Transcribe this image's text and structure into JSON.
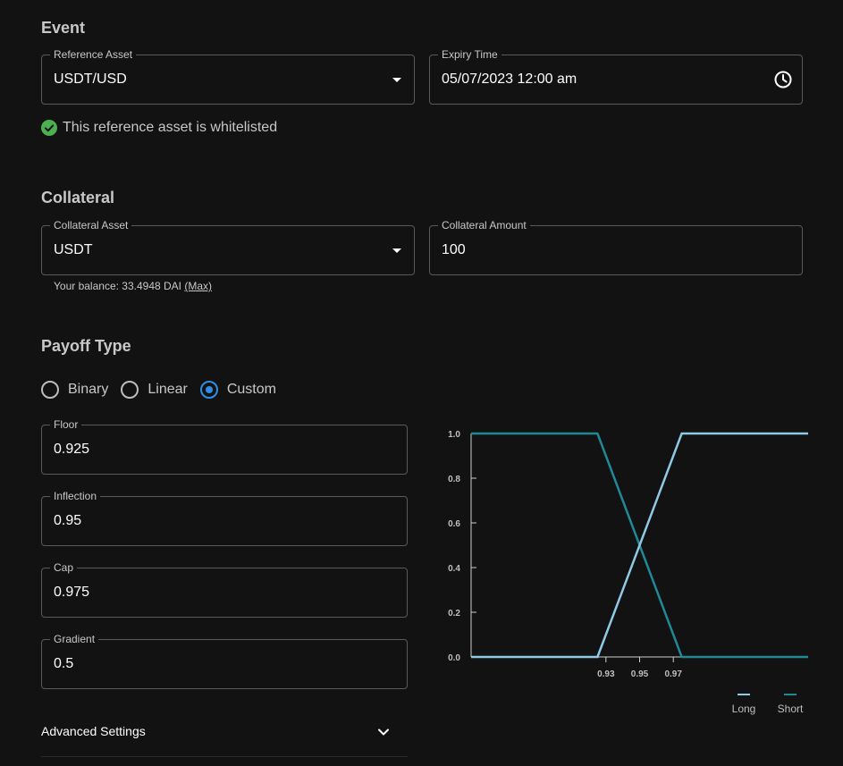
{
  "event": {
    "title": "Event",
    "reference_asset": {
      "label": "Reference Asset",
      "value": "USDT/USD"
    },
    "expiry_time": {
      "label": "Expiry Time",
      "value": "05/07/2023 12:00 am"
    },
    "whitelist_msg": "This reference asset is whitelisted"
  },
  "collateral": {
    "title": "Collateral",
    "asset": {
      "label": "Collateral Asset",
      "value": "USDT"
    },
    "amount": {
      "label": "Collateral Amount",
      "value": "100"
    },
    "balance_text": "Your balance: 33.4948 DAI",
    "max_label": "(Max)"
  },
  "payoff": {
    "title": "Payoff Type",
    "options": [
      "Binary",
      "Linear",
      "Custom"
    ],
    "selected": "Custom",
    "floor": {
      "label": "Floor",
      "value": "0.925"
    },
    "inflection": {
      "label": "Inflection",
      "value": "0.95"
    },
    "cap": {
      "label": "Cap",
      "value": "0.975"
    },
    "gradient": {
      "label": "Gradient",
      "value": "0.5"
    }
  },
  "advanced": {
    "label": "Advanced Settings"
  },
  "colors": {
    "long": "#8ecae6",
    "short": "#1f8a96",
    "accent": "#2e8ee6",
    "success": "#4caf50"
  },
  "chart_data": {
    "type": "line",
    "x_tick_labels": [
      "0.93",
      "0.95",
      "0.97"
    ],
    "y_ticks": [
      "0.0",
      "0.2",
      "0.4",
      "0.6",
      "0.8",
      "1.0"
    ],
    "ylim": [
      0,
      1
    ],
    "xlim": [
      0.85,
      1.05
    ],
    "legend_position": "bottom-right",
    "series": [
      {
        "name": "Long",
        "x": [
          0.85,
          0.925,
          0.975,
          1.05
        ],
        "y": [
          0,
          0,
          1,
          1
        ]
      },
      {
        "name": "Short",
        "x": [
          0.85,
          0.925,
          0.975,
          1.05
        ],
        "y": [
          1,
          1,
          0,
          0
        ]
      }
    ]
  }
}
